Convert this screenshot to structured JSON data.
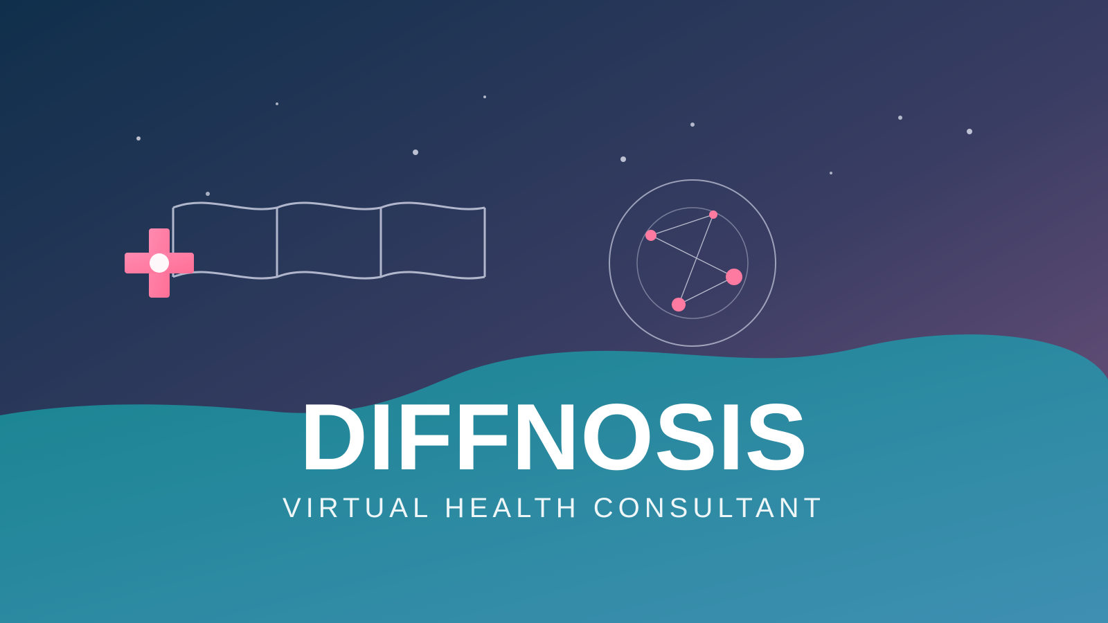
{
  "brand": {
    "title": "DIFFNOSIS",
    "tagline": "VIRTUAL HEALTH CONSULTANT"
  },
  "icons": {
    "left": "medical-cross-icon",
    "banner": "wavy-banner-icon",
    "right": "molecule-network-icon"
  },
  "colors": {
    "sky_top": "#0f2f4b",
    "sky_mid": "#3a3d63",
    "sky_bottom": "#6a4f7a",
    "wave_left": "#1c8698",
    "wave_right": "#3e8fb2",
    "accent": "#ff7aa0",
    "line": "#c9cde0",
    "text": "#ffffff"
  }
}
